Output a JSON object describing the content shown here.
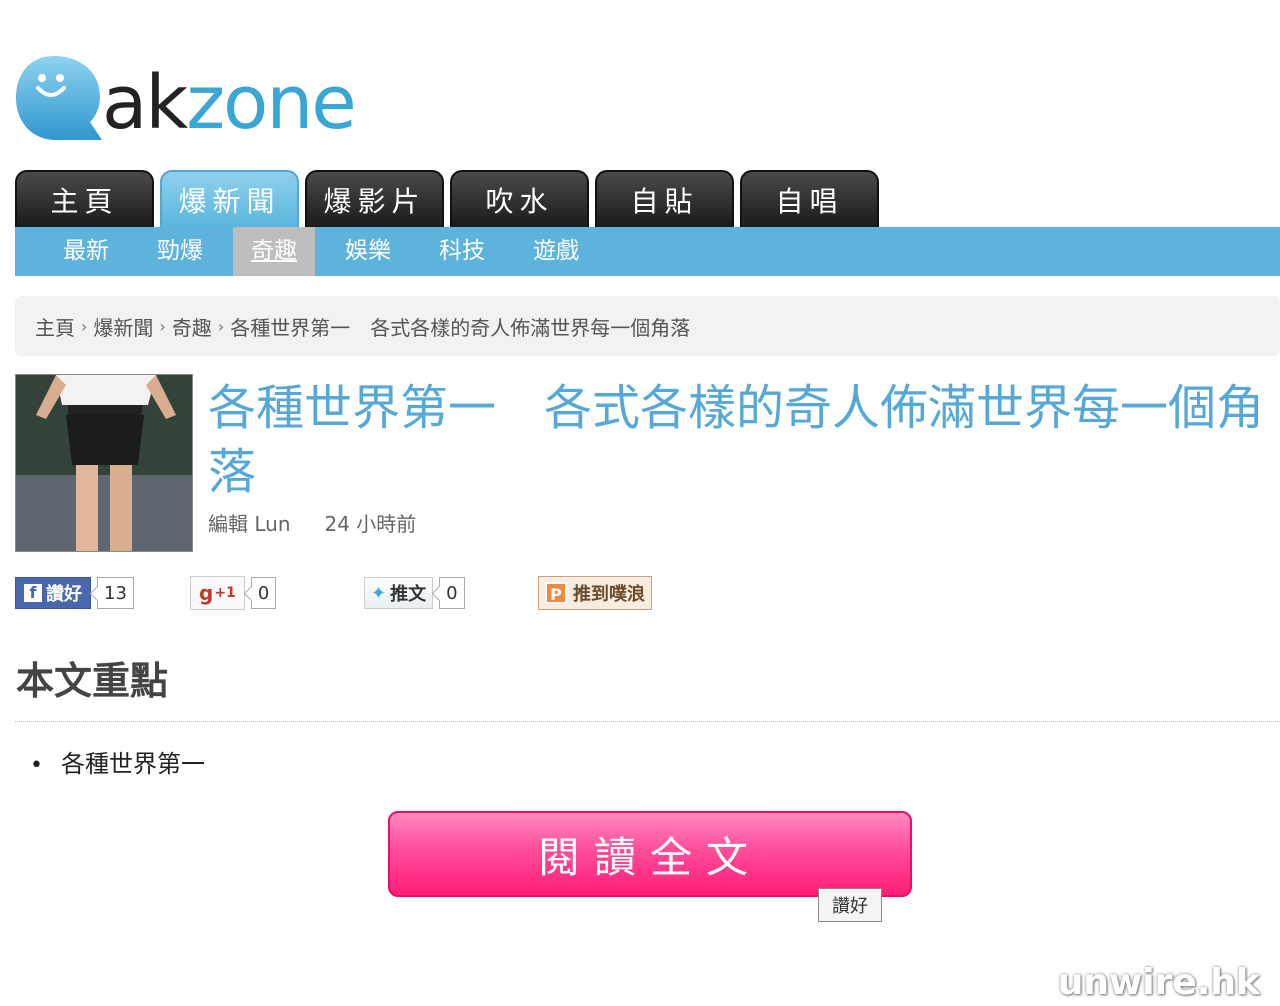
{
  "logo": {
    "ak": "ak",
    "zone": "zone"
  },
  "main_tabs": [
    {
      "label": "主頁"
    },
    {
      "label": "爆新聞"
    },
    {
      "label": "爆影片"
    },
    {
      "label": "吹水"
    },
    {
      "label": "自貼"
    },
    {
      "label": "自唱"
    }
  ],
  "sub_nav": [
    {
      "label": "最新"
    },
    {
      "label": "勁爆"
    },
    {
      "label": "奇趣"
    },
    {
      "label": "娛樂"
    },
    {
      "label": "科技"
    },
    {
      "label": "遊戲"
    }
  ],
  "breadcrumb": {
    "items": [
      "主頁",
      "爆新聞",
      "奇趣",
      "各種世界第一　各式各樣的奇人佈滿世界每一個角落"
    ],
    "separator": "›"
  },
  "article": {
    "title": "各種世界第一　各式各樣的奇人佈滿世界每一個角落",
    "author": "編輯 Lun",
    "time": "24 小時前"
  },
  "social": {
    "facebook": {
      "label": "讚好",
      "count": "13",
      "icon": "f"
    },
    "gplus": {
      "label": "g",
      "suffix": "+1",
      "count": "0"
    },
    "twitter": {
      "label": "推文",
      "count": "0"
    },
    "plurk": {
      "label": "推到噗浪",
      "icon": "P"
    }
  },
  "summary": {
    "heading": "本文重點",
    "items": [
      "各種世界第一"
    ]
  },
  "read_button": {
    "label": "閱讀全文"
  },
  "like_tooltip": {
    "label": "讚好"
  },
  "watermark": "unwire.hk",
  "colors": {
    "accent_blue": "#5db3dc",
    "title_blue": "#56a8d6",
    "read_pink": "#ff3d8c"
  }
}
